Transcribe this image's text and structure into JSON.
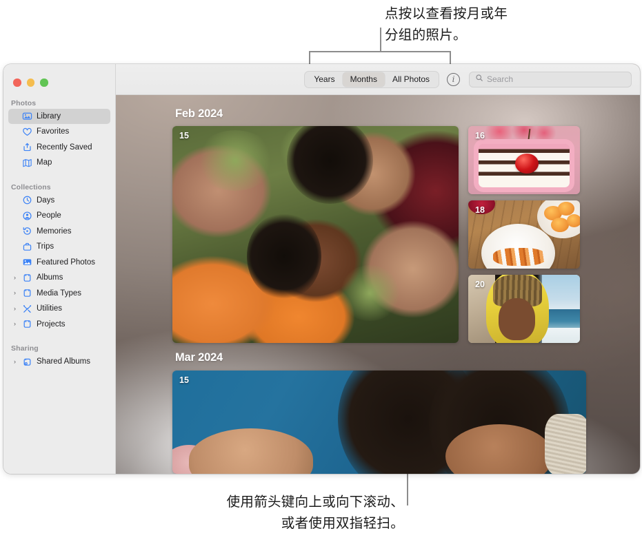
{
  "callouts": {
    "top": "点按以查看按月或年\n分组的照片。",
    "bottom": "使用箭头键向上或向下滚动、\n或者使用双指轻扫。"
  },
  "window": {
    "traffic_lights": [
      {
        "name": "close",
        "color": "#f2655a"
      },
      {
        "name": "minimize",
        "color": "#f5bd4f"
      },
      {
        "name": "zoom",
        "color": "#61c454"
      }
    ]
  },
  "sidebar": {
    "sections": [
      {
        "label": "Photos",
        "items": [
          {
            "label": "Library",
            "icon": "library-icon",
            "selected": true,
            "chevron": false
          },
          {
            "label": "Favorites",
            "icon": "heart-icon",
            "selected": false,
            "chevron": false
          },
          {
            "label": "Recently Saved",
            "icon": "tray-arrow-up-icon",
            "selected": false,
            "chevron": false
          },
          {
            "label": "Map",
            "icon": "map-icon",
            "selected": false,
            "chevron": false
          }
        ]
      },
      {
        "label": "Collections",
        "items": [
          {
            "label": "Days",
            "icon": "clock-icon",
            "selected": false,
            "chevron": false
          },
          {
            "label": "People",
            "icon": "person-circle-icon",
            "selected": false,
            "chevron": false
          },
          {
            "label": "Memories",
            "icon": "memories-icon",
            "selected": false,
            "chevron": false
          },
          {
            "label": "Trips",
            "icon": "suitcase-icon",
            "selected": false,
            "chevron": false
          },
          {
            "label": "Featured Photos",
            "icon": "featured-photo-icon",
            "selected": false,
            "chevron": false
          },
          {
            "label": "Albums",
            "icon": "album-icon",
            "selected": false,
            "chevron": true
          },
          {
            "label": "Media Types",
            "icon": "album-icon",
            "selected": false,
            "chevron": true
          },
          {
            "label": "Utilities",
            "icon": "tools-icon",
            "selected": false,
            "chevron": true
          },
          {
            "label": "Projects",
            "icon": "album-icon",
            "selected": false,
            "chevron": true
          }
        ]
      },
      {
        "label": "Sharing",
        "items": [
          {
            "label": "Shared Albums",
            "icon": "shared-album-icon",
            "selected": false,
            "chevron": true
          }
        ]
      }
    ]
  },
  "toolbar": {
    "segments": [
      {
        "label": "Years",
        "active": false
      },
      {
        "label": "Months",
        "active": true
      },
      {
        "label": "All Photos",
        "active": false
      }
    ],
    "info_button": "i",
    "search": {
      "placeholder": "Search",
      "value": ""
    }
  },
  "grid": {
    "groups": [
      {
        "title": "Feb 2024",
        "photos": [
          {
            "badge": "15",
            "subject": "group-selfie"
          },
          {
            "badge": "16",
            "subject": "cake-slice"
          },
          {
            "badge": "18",
            "subject": "plated-food"
          },
          {
            "badge": "20",
            "subject": "person-beach"
          }
        ]
      },
      {
        "title": "Mar 2024",
        "photos": [
          {
            "badge": "15",
            "subject": "two-people-blue-backdrop"
          }
        ]
      }
    ]
  },
  "colors": {
    "accent": "#3b82f6",
    "sidebar_bg": "#ececec",
    "selected_row": "#d2d2d2",
    "leader_line": "#8c8c8c"
  }
}
